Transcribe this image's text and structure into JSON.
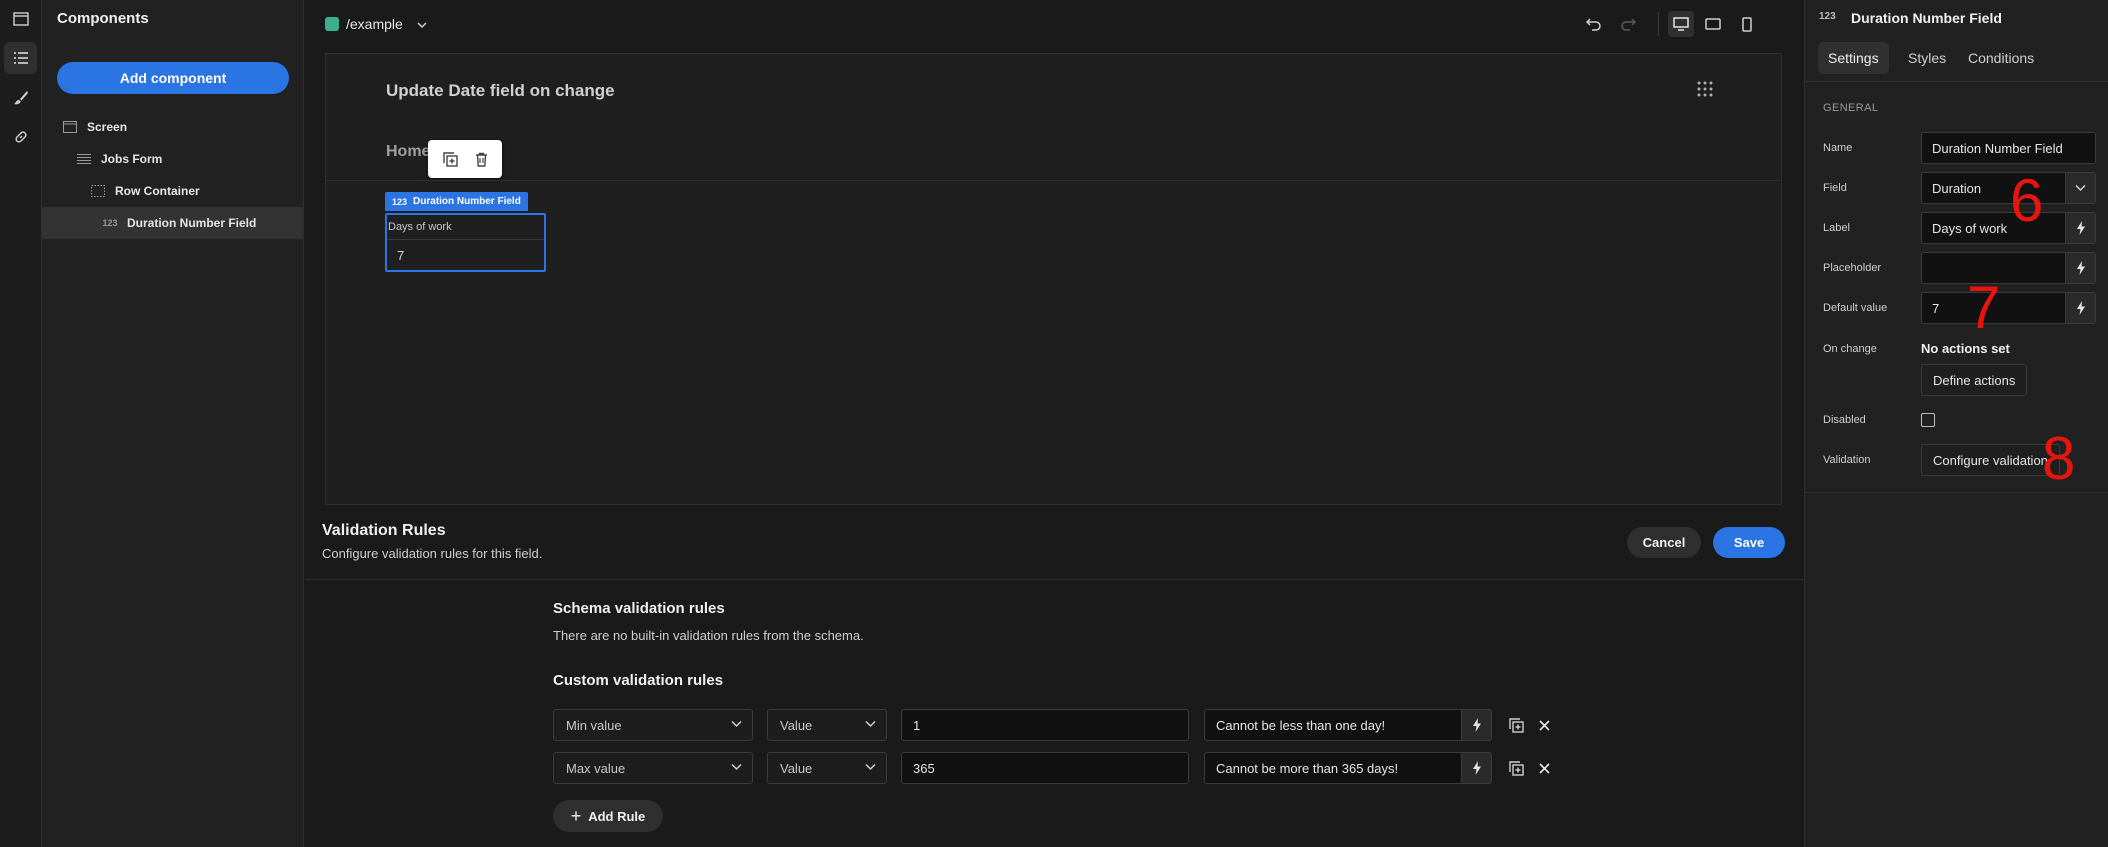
{
  "components_panel": {
    "title": "Components",
    "add_button": "Add component",
    "tree": [
      {
        "label": "Screen",
        "icon": "screen-icon"
      },
      {
        "label": "Jobs Form",
        "icon": "form-icon"
      },
      {
        "label": "Row Container",
        "icon": "container-icon"
      },
      {
        "label": "Duration Number Field",
        "icon": "number-field-icon",
        "icon_text": "123",
        "selected": true
      }
    ]
  },
  "topbar": {
    "route": "/example"
  },
  "preview": {
    "title": "Update Date field on change",
    "nav_home": "Home",
    "component_badge_num": "123",
    "component_badge": "Duration Number Field",
    "field_label": "Days of work",
    "field_value": "7"
  },
  "validation": {
    "title": "Validation Rules",
    "subtitle": "Configure validation rules for this field.",
    "cancel": "Cancel",
    "save": "Save",
    "schema_title": "Schema validation rules",
    "schema_text": "There are no built-in validation rules from the schema.",
    "custom_title": "Custom validation rules",
    "rules": [
      {
        "constraint": "Min value",
        "type": "Value",
        "value": "1",
        "error": "Cannot be less than one day!"
      },
      {
        "constraint": "Max value",
        "type": "Value",
        "value": "365",
        "error": "Cannot be more than 365 days!"
      }
    ],
    "add_rule": "Add Rule"
  },
  "settings": {
    "icon_text": "123",
    "title": "Duration Number Field",
    "tabs": [
      "Settings",
      "Styles",
      "Conditions"
    ],
    "section": "GENERAL",
    "name_label": "Name",
    "name_value": "Duration Number Field",
    "field_label": "Field",
    "field_value": "Duration",
    "label_label": "Label",
    "label_value": "Days of work",
    "placeholder_label": "Placeholder",
    "placeholder_value": "",
    "default_label": "Default value",
    "default_value": "7",
    "onchange_label": "On change",
    "onchange_value": "No actions set",
    "define_actions": "Define actions",
    "disabled_label": "Disabled",
    "validation_label": "Validation",
    "configure_validation": "Configure validation"
  },
  "annotations": [
    "6",
    "7",
    "8"
  ],
  "colors": {
    "accent": "#2a74e4",
    "route_dot": "#3cb08a",
    "annotation": "#e8150e"
  }
}
